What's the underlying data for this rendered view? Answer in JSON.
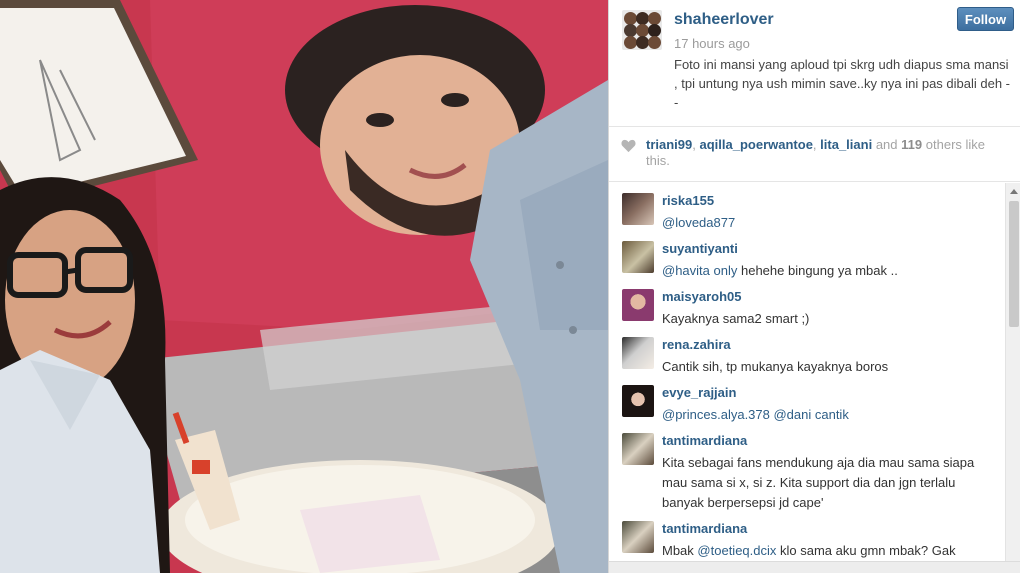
{
  "post": {
    "username": "shaheerlover",
    "time": "17 hours ago",
    "follow_label": "Follow",
    "caption": "Foto ini mansi yang aploud tpi skrg udh diapus sma mansi , tpi untung nya ush mimin save..ky nya ini pas dibali deh -     -"
  },
  "likes": {
    "user1": "triani99",
    "sep1": ",",
    "user2": "aqilla_poerwantoe",
    "sep2": ",",
    "user3": "lita_liani",
    "and_text": "and",
    "count": "119",
    "others_text": "others like this."
  },
  "comments": [
    {
      "user": "riska155",
      "mention": "@loveda877",
      "text": ""
    },
    {
      "user": "suyantiyanti",
      "mention": "@havita  only",
      "text": "hehehe bingung ya mbak .."
    },
    {
      "user": "maisyaroh05",
      "mention": "",
      "text": "Kayaknya sama2 smart ;)"
    },
    {
      "user": "rena.zahira",
      "mention": "",
      "text": "Cantik sih, tp mukanya kayaknya boros"
    },
    {
      "user": "evye_rajjain",
      "mention": "@princes.alya.378 @dani  cantik",
      "text": ""
    },
    {
      "user": "tantimardiana",
      "mention": "",
      "text": "Kita sebagai fans mendukung aja dia mau sama siapa mau sama si x, si z. Kita support dia dan jgn terlalu banyak berpersepsi jd cape'"
    },
    {
      "user": "tantimardiana",
      "prefix": "Mbak",
      "mention": "@toetieq.dcix",
      "text": "klo sama aku gmn mbak? Gak"
    }
  ],
  "icons": {
    "heart": "heart-icon",
    "scroll_up": "scroll-up-arrow-icon"
  },
  "colors": {
    "link": "#2e5e86",
    "follow_button": "#4a7cab",
    "photo_wall": "#c0314e"
  }
}
